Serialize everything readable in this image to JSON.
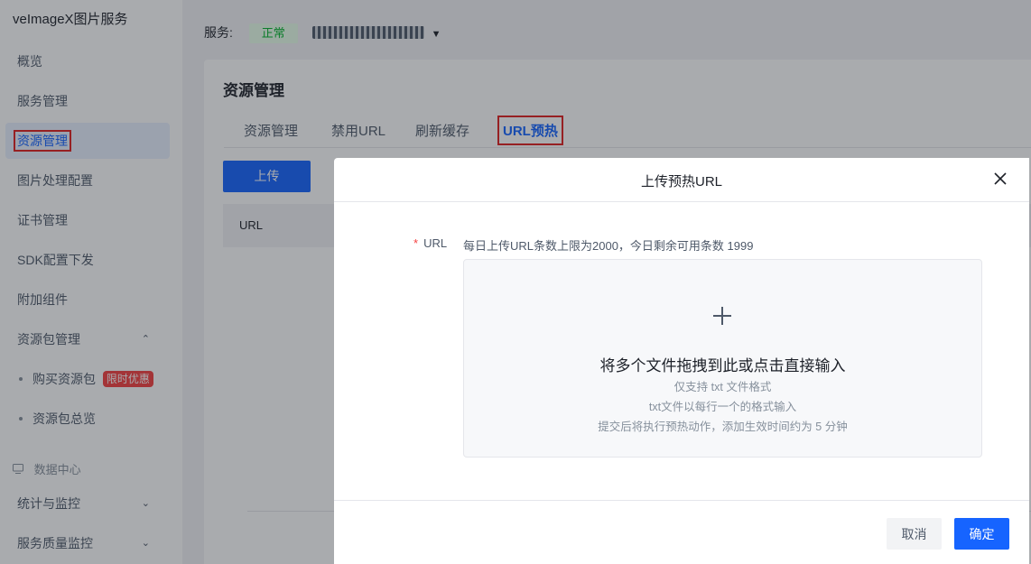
{
  "sidebar": {
    "app_title": "veImageX图片服务",
    "items": [
      {
        "label": "概览"
      },
      {
        "label": "服务管理"
      },
      {
        "label": "资源管理"
      },
      {
        "label": "图片处理配置"
      },
      {
        "label": "证书管理"
      },
      {
        "label": "SDK配置下发"
      },
      {
        "label": "附加组件"
      },
      {
        "label": "资源包管理"
      }
    ],
    "sub_items": [
      {
        "label": "购买资源包",
        "badge": "限时优惠"
      },
      {
        "label": "资源包总览"
      }
    ],
    "group_label": "数据中心",
    "more_items": [
      {
        "label": "统计与监控"
      },
      {
        "label": "服务质量监控"
      }
    ],
    "active_index": 2
  },
  "service_bar": {
    "label": "服务:",
    "status": "正常"
  },
  "card": {
    "title": "资源管理",
    "tabs": [
      {
        "label": "资源管理"
      },
      {
        "label": "禁用URL"
      },
      {
        "label": "刷新缓存"
      },
      {
        "label": "URL预热"
      }
    ],
    "active_tab": 3,
    "upload_label": "上传",
    "table_header_url": "URL"
  },
  "modal": {
    "title": "上传预热URL",
    "field_label": "URL",
    "required_mark": "*",
    "hint": "每日上传URL条数上限为2000，今日剩余可用条数 1999",
    "dropzone": {
      "main_text": "将多个文件拖拽到此或点击直接输入",
      "line1": "仅支持 txt 文件格式",
      "line2": "txt文件以每行一个的格式输入",
      "line3": "提交后将执行预热动作，添加生效时间约为 5 分钟"
    },
    "cancel_label": "取消",
    "ok_label": "确定"
  },
  "colors": {
    "primary": "#1664ff",
    "highlight_box": "#e02020",
    "status_green": "#00b42a",
    "badge_red": "#f53f3f"
  }
}
